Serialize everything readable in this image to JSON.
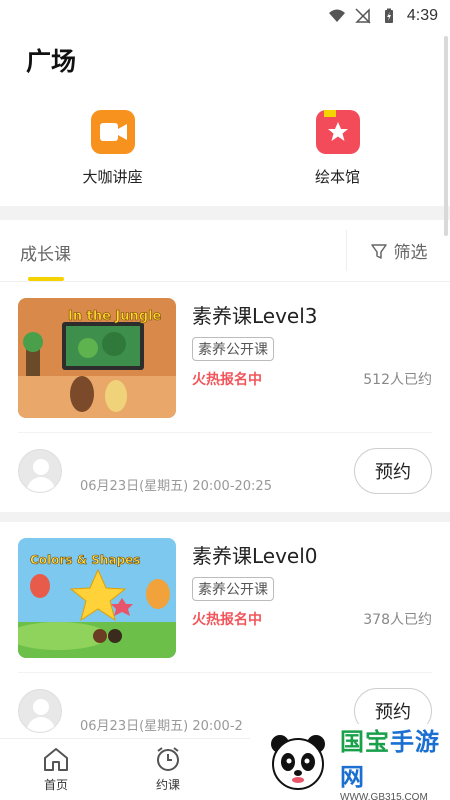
{
  "status": {
    "time": "4:39"
  },
  "page": {
    "title": "广场"
  },
  "entries": [
    {
      "label": "大咖讲座",
      "icon": "video-icon"
    },
    {
      "label": "绘本馆",
      "icon": "book-star-icon"
    }
  ],
  "tabs": {
    "active": "成长课",
    "filter_label": "筛选"
  },
  "courses": [
    {
      "title": "素养课Level3",
      "tag": "素养公开课",
      "status": "火热报名中",
      "booked": "512人已约",
      "thumb_text": "In the Jungle",
      "time": "06月23日(星期五) 20:00-20:25",
      "button": "预约"
    },
    {
      "title": "素养课Level0",
      "tag": "素养公开课",
      "status": "火热报名中",
      "booked": "378人已约",
      "thumb_text": "Colors & Shapes",
      "time": "06月23日(星期五) 20:00-2",
      "button": "预约"
    }
  ],
  "nav": [
    {
      "label": "首页",
      "icon": "home-icon"
    },
    {
      "label": "约课",
      "icon": "alarm-clock-icon"
    }
  ],
  "watermark": {
    "title_green": "国宝",
    "title_blue": "手游网",
    "url": "WWW.GB315.COM"
  },
  "colors": {
    "accent": "#f5d300",
    "hot": "#f2555a",
    "video": "#f7921e",
    "book": "#f44b5b"
  }
}
